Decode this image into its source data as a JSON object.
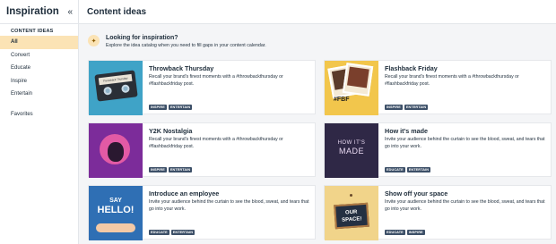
{
  "sidebar": {
    "title": "Inspiration",
    "collapse_icon": "«",
    "section_label": "CONTENT IDEAS",
    "items": [
      {
        "label": "All",
        "active": true
      },
      {
        "label": "Convert"
      },
      {
        "label": "Educate"
      },
      {
        "label": "Inspire"
      },
      {
        "label": "Entertain"
      }
    ],
    "favorites_label": "Favorites"
  },
  "main": {
    "title": "Content ideas",
    "banner": {
      "icon": "✦",
      "title": "Looking for inspiration?",
      "subtitle": "Explore the idea catalog when you need to fill gaps in your content calendar."
    },
    "cards": [
      {
        "title": "Throwback Thursday",
        "desc": "Recall your brand's finest moments with a #throwbackthursday or #flashbackfriday post.",
        "tags": [
          "INSPIRE",
          "ENTERTAIN"
        ],
        "thumb_text": "Throwback Thursday"
      },
      {
        "title": "Flashback Friday",
        "desc": "Recall your brand's finest moments with a #throwbackthursday or #flashbackfriday post.",
        "tags": [
          "INSPIRE",
          "ENTERTAIN"
        ],
        "thumb_text": "#FBF"
      },
      {
        "title": "Y2K Nostalgia",
        "desc": "Recall your brand's finest moments with a #throwbackthursday or #flashbackfriday post.",
        "tags": [
          "INSPIRE",
          "ENTERTAIN"
        ]
      },
      {
        "title": "How it's made",
        "desc": "Invite your audience behind the curtain to see the blood, sweat, and tears that go into your work.",
        "tags": [
          "EDUCATE",
          "ENTERTAIN"
        ],
        "thumb_line1": "HOW IT'S",
        "thumb_line2": "MADE"
      },
      {
        "title": "Introduce an employee",
        "desc": "Invite your audience behind the curtain to see the blood, sweat, and tears that go into your work.",
        "tags": [
          "EDUCATE",
          "ENTERTAIN"
        ],
        "thumb_line1": "SAY",
        "thumb_line2": "HELLO!"
      },
      {
        "title": "Show off your space",
        "desc": "Invite your audience behind the curtain to see the blood, sweat, and tears that go into your work.",
        "tags": [
          "EDUCATE",
          "INSPIRE"
        ],
        "thumb_line1": "OUR",
        "thumb_line2": "SPACE!"
      }
    ]
  },
  "colors": {
    "active_bg": "#fbe3b5",
    "tag_bg": "#3d5068",
    "text": "#1d2c3a"
  }
}
